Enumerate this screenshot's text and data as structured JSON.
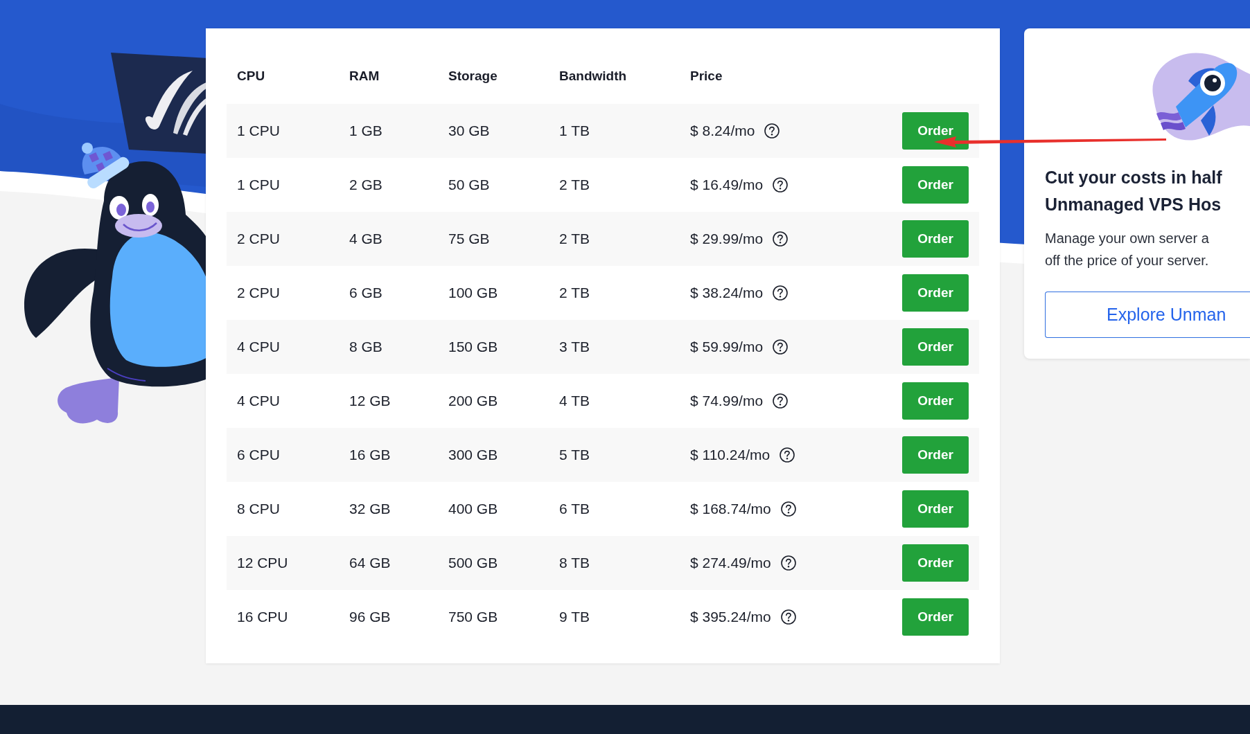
{
  "pricing_table": {
    "columns": [
      "CPU",
      "RAM",
      "Storage",
      "Bandwidth",
      "Price"
    ],
    "rows": [
      {
        "cpu": "1 CPU",
        "ram": "1 GB",
        "storage": "30 GB",
        "bandwidth": "1 TB",
        "price": "$ 8.24/mo",
        "action": "Order"
      },
      {
        "cpu": "1 CPU",
        "ram": "2 GB",
        "storage": "50 GB",
        "bandwidth": "2 TB",
        "price": "$ 16.49/mo",
        "action": "Order"
      },
      {
        "cpu": "2 CPU",
        "ram": "4 GB",
        "storage": "75 GB",
        "bandwidth": "2 TB",
        "price": "$ 29.99/mo",
        "action": "Order"
      },
      {
        "cpu": "2 CPU",
        "ram": "6 GB",
        "storage": "100 GB",
        "bandwidth": "2 TB",
        "price": "$ 38.24/mo",
        "action": "Order"
      },
      {
        "cpu": "4 CPU",
        "ram": "8 GB",
        "storage": "150 GB",
        "bandwidth": "3 TB",
        "price": "$ 59.99/mo",
        "action": "Order"
      },
      {
        "cpu": "4 CPU",
        "ram": "12 GB",
        "storage": "200 GB",
        "bandwidth": "4 TB",
        "price": "$ 74.99/mo",
        "action": "Order"
      },
      {
        "cpu": "6 CPU",
        "ram": "16 GB",
        "storage": "300 GB",
        "bandwidth": "5 TB",
        "price": "$ 110.24/mo",
        "action": "Order"
      },
      {
        "cpu": "8 CPU",
        "ram": "32 GB",
        "storage": "400 GB",
        "bandwidth": "6 TB",
        "price": "$ 168.74/mo",
        "action": "Order"
      },
      {
        "cpu": "12 CPU",
        "ram": "64 GB",
        "storage": "500 GB",
        "bandwidth": "8 TB",
        "price": "$ 274.49/mo",
        "action": "Order"
      },
      {
        "cpu": "16 CPU",
        "ram": "96 GB",
        "storage": "750 GB",
        "bandwidth": "9 TB",
        "price": "$ 395.24/mo",
        "action": "Order"
      }
    ]
  },
  "promo_card": {
    "title_lines": [
      "Cut your costs in half",
      "Unmanaged VPS Hos"
    ],
    "description_lines": [
      "Manage your own server a",
      "off the price of your server."
    ],
    "button": "Explore Unman"
  }
}
